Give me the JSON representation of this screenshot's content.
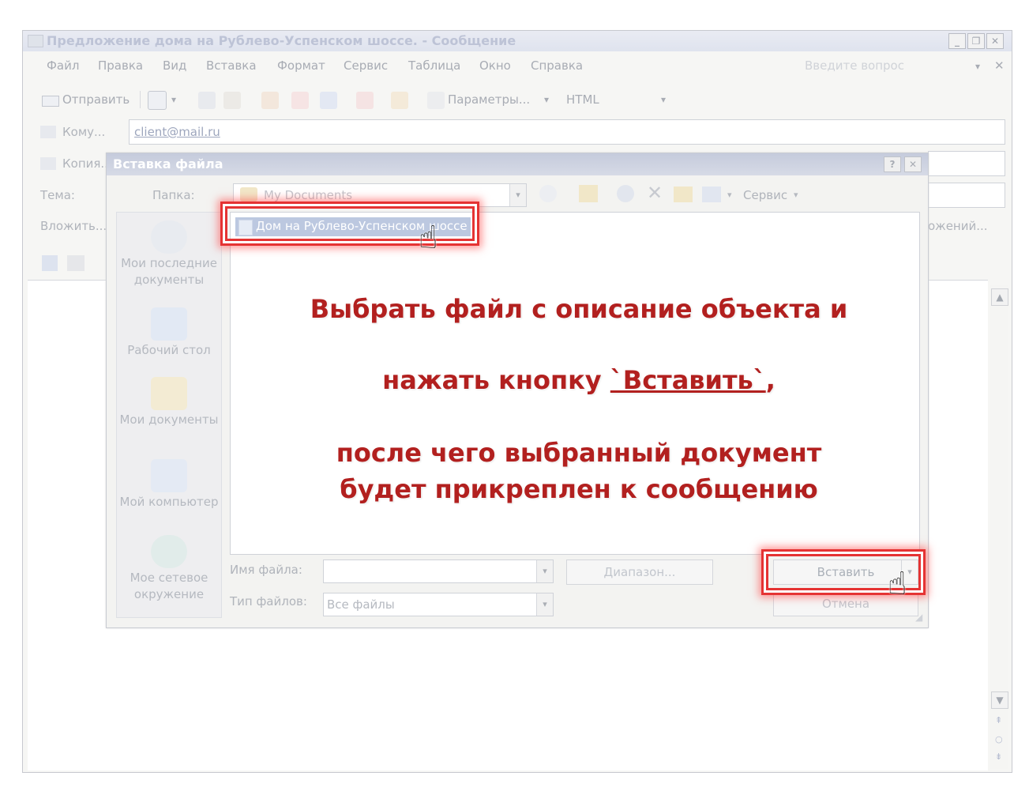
{
  "window": {
    "title": "Предложение дома на Рублево-Успенском шоссе. - Сообщение",
    "controls": [
      "_",
      "❐",
      "✕"
    ]
  },
  "menu": {
    "items": [
      "Файл",
      "Правка",
      "Вид",
      "Вставка",
      "Формат",
      "Сервис",
      "Таблица",
      "Окно",
      "Справка"
    ],
    "help_placeholder": "Введите вопрос",
    "help_arrow": "▾",
    "help_close": "✕"
  },
  "toolbar": {
    "send": "Отправить",
    "options": "Параметры...",
    "format": "HTML",
    "dropdown_arrow": "▾"
  },
  "fields": {
    "to_label": "Кому...",
    "to_value": "client@mail.ru",
    "cc_label": "Копия...",
    "subject_label": "Тема:",
    "attach_label": "Вложить...",
    "attach_right": "ожений..."
  },
  "dialog": {
    "title": "Вставка файла",
    "help_btn": "?",
    "close_btn": "✕",
    "folder_label": "Папка:",
    "folder_value": "My Documents",
    "service": "Сервис",
    "places": [
      "Мои последние документы",
      "Рабочий стол",
      "Мои документы",
      "Мой компьютер",
      "Мое сетевое окружение"
    ],
    "selected_file": "Дом на Рублево-Успенском шоссе",
    "filename_label": "Имя файла:",
    "filetype_label": "Тип файлов:",
    "filetype_value": "Все файлы",
    "range_btn": "Диапазон...",
    "insert_btn": "Вставить",
    "cancel_btn": "Отмена"
  },
  "instructions": {
    "line1": "Выбрать файл с описание объекта и",
    "line2_prefix": "нажать кнопку ",
    "line2_button": "`Вставить`",
    "line2_suffix": ",",
    "line3": "после чего выбранный документ",
    "line4": "будет прикреплен к сообщению"
  },
  "colors": {
    "highlight": "#e53333",
    "caption": "#b2201f"
  }
}
